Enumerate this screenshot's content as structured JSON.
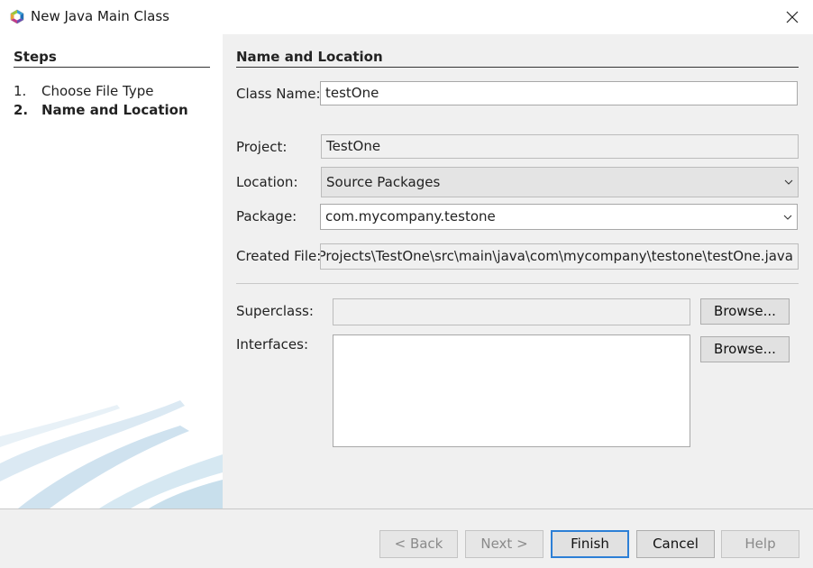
{
  "window": {
    "title": "New Java Main Class",
    "icon": "netbeans-logo-icon"
  },
  "steps": {
    "heading": "Steps",
    "items": [
      {
        "num": "1.",
        "label": "Choose File Type",
        "current": false
      },
      {
        "num": "2.",
        "label": "Name and Location",
        "current": true
      }
    ]
  },
  "content": {
    "heading": "Name and Location",
    "class_name": {
      "label": "Class Name:",
      "value": "testOne"
    },
    "project": {
      "label": "Project:",
      "value": "TestOne"
    },
    "location": {
      "label": "Location:",
      "value": "Source Packages"
    },
    "package": {
      "label": "Package:",
      "value": "com.mycompany.testone"
    },
    "created_file": {
      "label": "Created File:",
      "value": "C:\\Users\\User\\Documents\\NetBeansProjects\\TestOne\\src\\main\\java\\com\\mycompany\\testone\\testOne.java"
    },
    "superclass": {
      "label": "Superclass:",
      "value": "",
      "browse": "Browse..."
    },
    "interfaces": {
      "label": "Interfaces:",
      "browse": "Browse..."
    }
  },
  "buttons": {
    "back": "< Back",
    "next": "Next >",
    "finish": "Finish",
    "cancel": "Cancel",
    "help": "Help"
  },
  "colors": {
    "accent": "#2c7fd6",
    "panel_bg": "#f0f0f0"
  }
}
